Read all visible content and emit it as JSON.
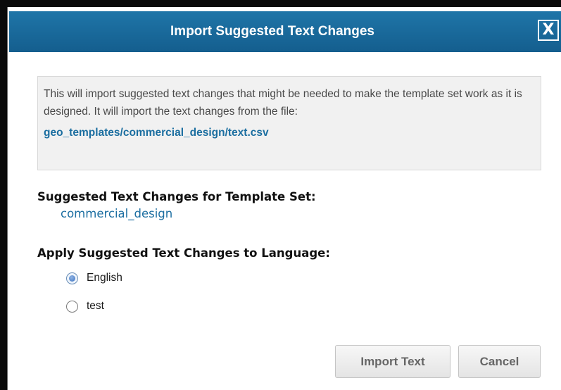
{
  "dialog": {
    "title": "Import Suggested Text Changes",
    "close_label": "X"
  },
  "info": {
    "text": "This will import suggested text changes that might be needed to make the template set work as it is designed. It will import the text changes from the file:",
    "file_path": "geo_templates/commercial_design/text.csv"
  },
  "template_set": {
    "heading": "Suggested Text Changes for Template Set:",
    "name": "commercial_design"
  },
  "language": {
    "heading": "Apply Suggested Text Changes to Language:",
    "options": [
      {
        "label": "English",
        "checked": true
      },
      {
        "label": "test",
        "checked": false
      }
    ]
  },
  "buttons": {
    "import_label": "Import Text",
    "cancel_label": "Cancel"
  },
  "colors": {
    "titlebar": "#1b6ba0",
    "link": "#1b6ea0",
    "info_background": "#f1f1f1"
  }
}
